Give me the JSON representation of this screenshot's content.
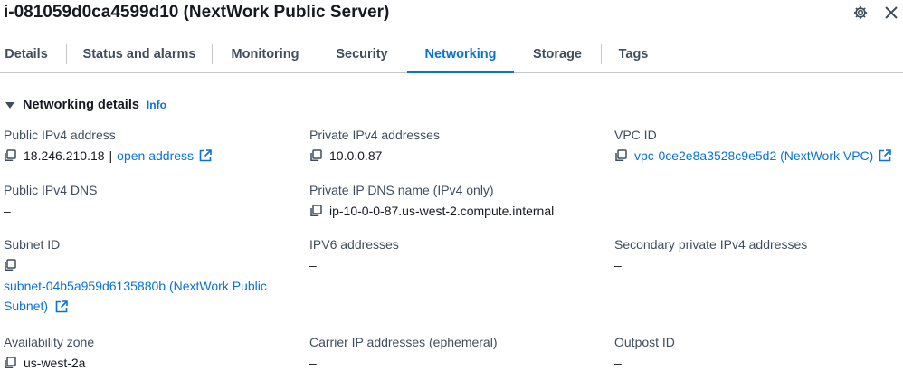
{
  "header": {
    "title": "i-081059d0ca4599d10 (NextWork Public Server)",
    "settings_icon": "gear-icon",
    "close_icon": "close-icon"
  },
  "tabs": [
    {
      "label": "Details",
      "active": false
    },
    {
      "label": "Status and alarms",
      "active": false
    },
    {
      "label": "Monitoring",
      "active": false
    },
    {
      "label": "Security",
      "active": false
    },
    {
      "label": "Networking",
      "active": true
    },
    {
      "label": "Storage",
      "active": false
    },
    {
      "label": "Tags",
      "active": false
    }
  ],
  "section": {
    "title": "Networking details",
    "info": "Info"
  },
  "fields": {
    "public_ipv4": {
      "label": "Public IPv4 address",
      "value": "18.246.210.18",
      "separator": "|",
      "link": "open address"
    },
    "private_ipv4": {
      "label": "Private IPv4 addresses",
      "value": "10.0.0.87"
    },
    "vpc_id": {
      "label": "VPC ID",
      "value": "vpc-0ce2e8a3528c9e5d2 (NextWork VPC)"
    },
    "public_dns": {
      "label": "Public IPv4 DNS",
      "value": "–"
    },
    "private_dns": {
      "label": "Private IP DNS name (IPv4 only)",
      "value": "ip-10-0-0-87.us-west-2.compute.internal"
    },
    "subnet_id": {
      "label": "Subnet ID",
      "value_line1": "subnet-04b5a959d6135880b (NextWork Public",
      "value_line2": "Subnet)"
    },
    "ipv6": {
      "label": "IPV6 addresses",
      "value": "–"
    },
    "secondary_private": {
      "label": "Secondary private IPv4 addresses",
      "value": "–"
    },
    "availability_zone": {
      "label": "Availability zone",
      "value": "us-west-2a"
    },
    "carrier_ip": {
      "label": "Carrier IP addresses (ephemeral)",
      "value": "–"
    },
    "outpost_id": {
      "label": "Outpost ID",
      "value": "–"
    }
  },
  "colors": {
    "link": "#0972d3",
    "text": "#16191f",
    "label": "#414d5c",
    "divider": "#c6c6cd"
  }
}
